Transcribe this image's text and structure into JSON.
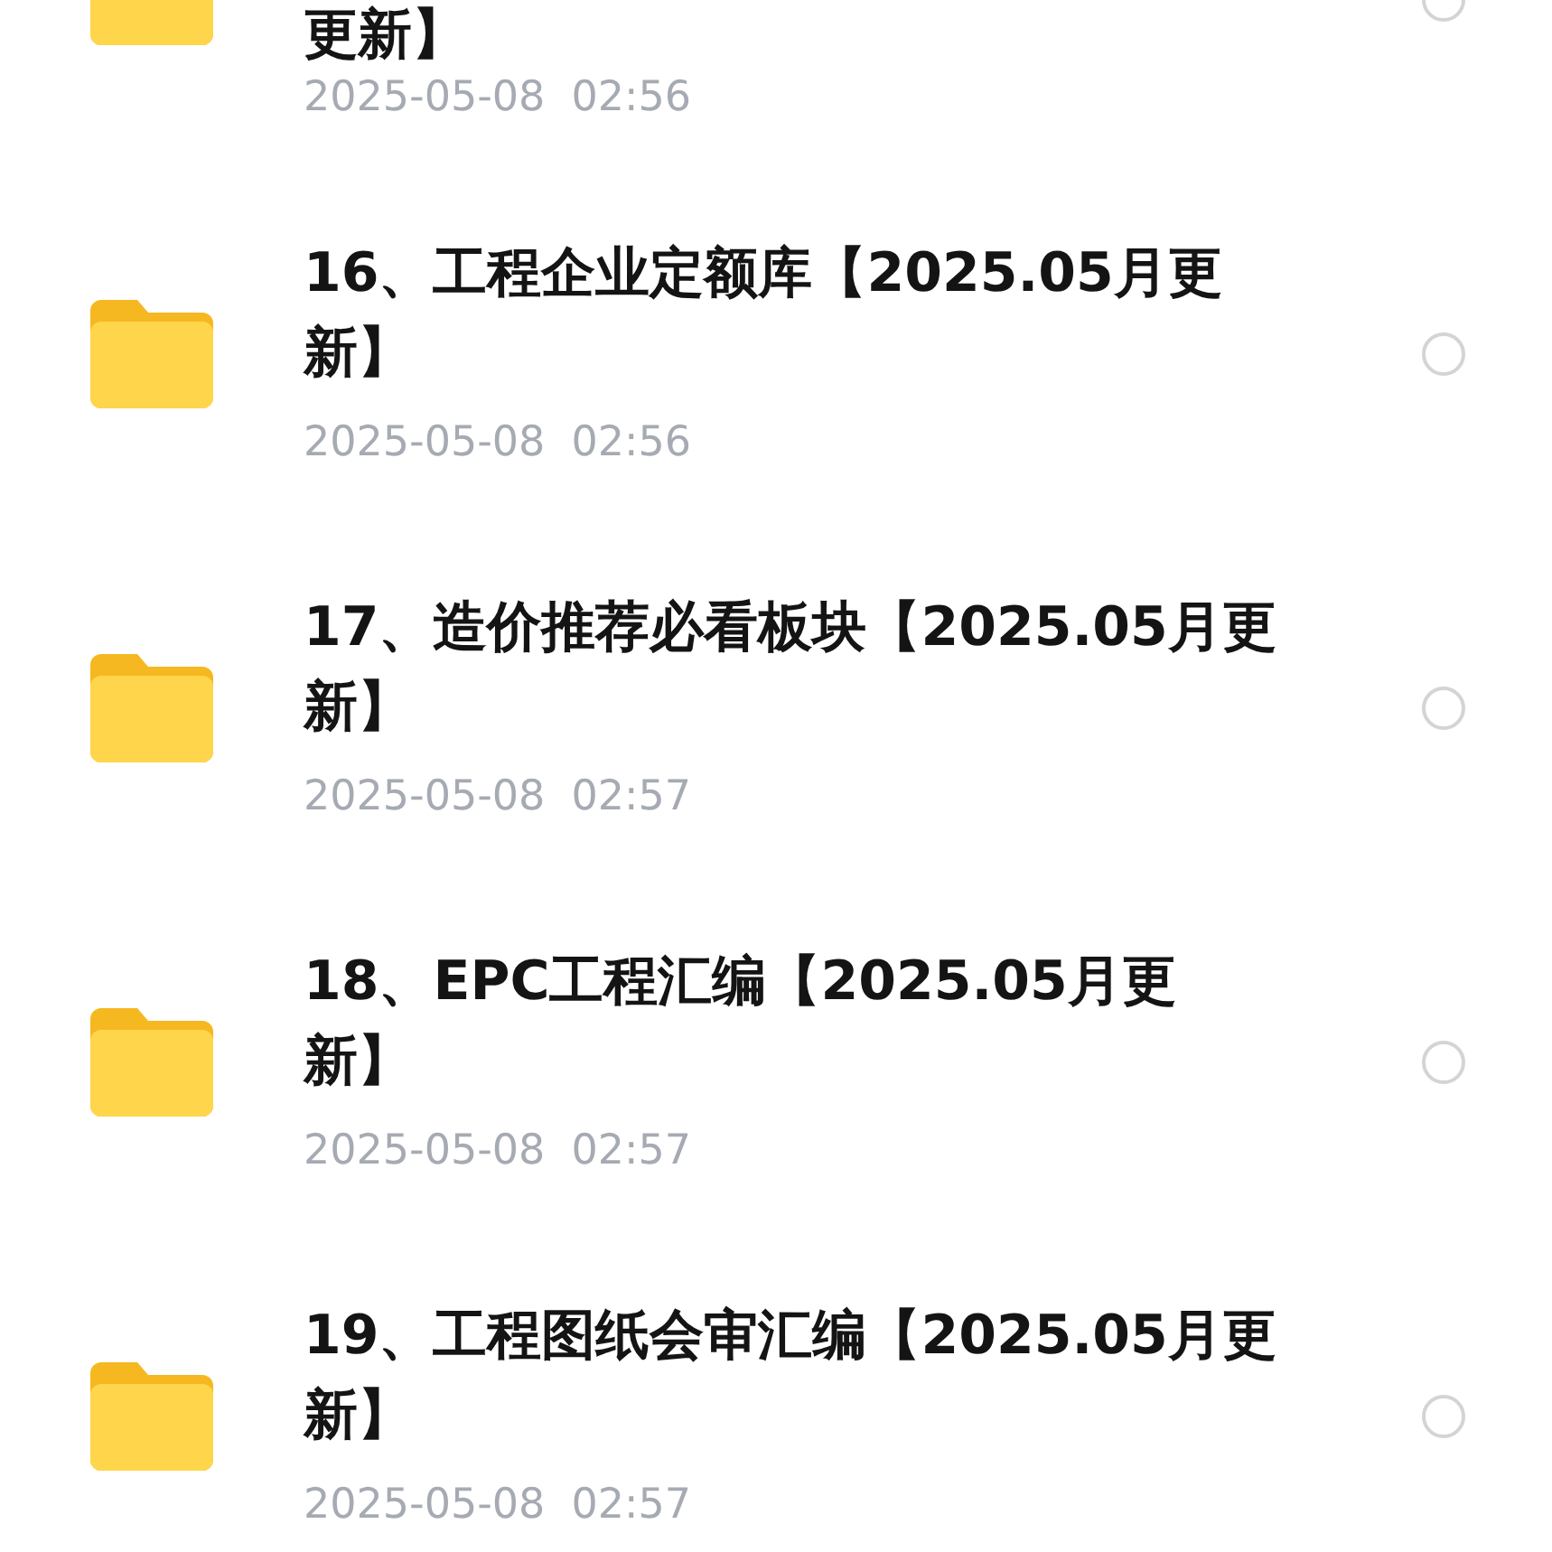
{
  "files": [
    {
      "name": "更新】",
      "date": "2025-05-08  02:56",
      "selected": false,
      "cut": true
    },
    {
      "name": "16、工程企业定额库【2025.05月更新】",
      "date": "2025-05-08  02:56",
      "selected": false
    },
    {
      "name": "17、造价推荐必看板块【2025.05月更新】",
      "date": "2025-05-08  02:57",
      "selected": false
    },
    {
      "name": "18、EPC工程汇编【2025.05月更新】",
      "date": "2025-05-08  02:57",
      "selected": false
    },
    {
      "name": "19、工程图纸会审汇编【2025.05月更新】",
      "date": "2025-05-08  02:57",
      "selected": false
    }
  ]
}
